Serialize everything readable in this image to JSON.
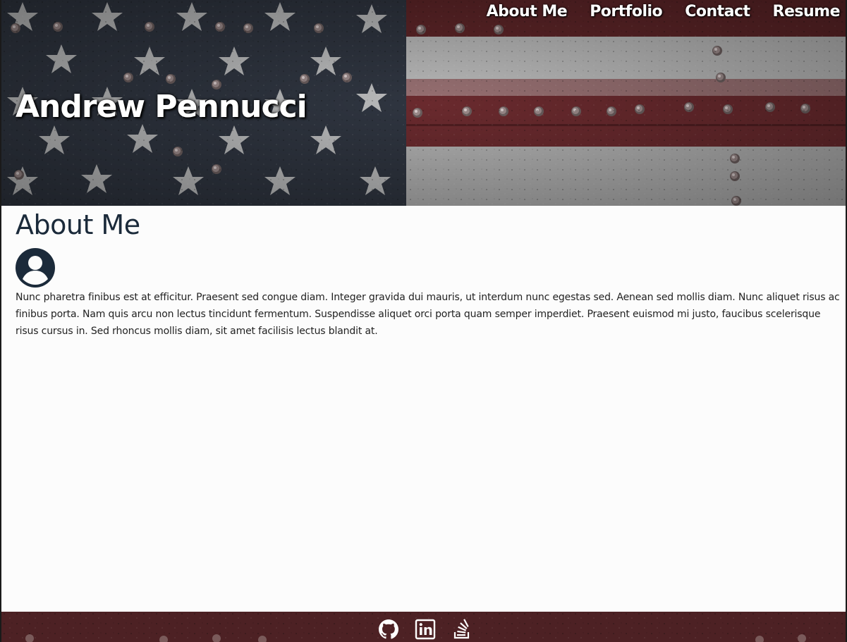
{
  "header": {
    "site_title": "Andrew Pennucci",
    "nav": [
      {
        "label": "About Me"
      },
      {
        "label": "Portfolio"
      },
      {
        "label": "Contact"
      },
      {
        "label": "Resume"
      }
    ]
  },
  "main": {
    "section_title": "About Me",
    "avatar_icon": "user-circle-icon",
    "bio": "Nunc pharetra finibus est at efficitur. Praesent sed congue diam. Integer gravida dui mauris, ut interdum nunc egestas sed. Aenean sed mollis diam. Nunc aliquet risus ac finibus porta. Nam quis arcu non lectus tincidunt fermentum. Suspendisse aliquet orci porta quam semper imperdiet. Praesent euismod mi justo, faucibus scelerisque risus cursus in. Sed rhoncus mollis diam, sit amet facilisis lectus blandit at."
  },
  "footer": {
    "icons": [
      "github-icon",
      "linkedin-icon",
      "stackoverflow-icon"
    ]
  },
  "colors": {
    "heading": "#1b2a3a",
    "text": "#222222",
    "background": "#fcfcfc",
    "flag_blue": "#2f3540",
    "flag_red": "#6e2a2e",
    "flag_white": "#b9b9b9"
  }
}
